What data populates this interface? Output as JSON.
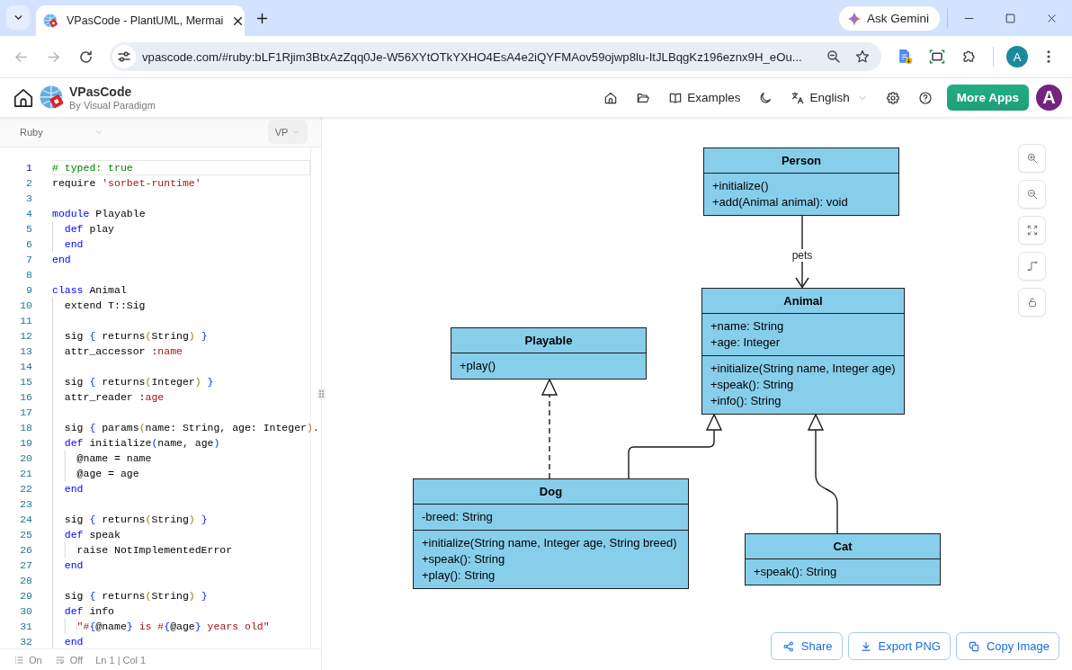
{
  "browser": {
    "tabs": [
      {
        "title": "VPasCode - PlantUML, Mermai",
        "selected": true
      }
    ],
    "gemini": "Ask Gemini",
    "nav": [
      {
        "kind": "back",
        "disabled": true
      },
      {
        "kind": "forward",
        "disabled": true
      },
      {
        "kind": "reload",
        "disabled": false
      }
    ],
    "url": "vpascode.com/#ruby:bLF1Rjim3BtxAzZqq0Je-W56XYtOTkYXHO4EsA4e2iQYFMAov59ojwp8lu-ItJLBqgKz196eznx9H_eOu...",
    "profile_initial": "A"
  },
  "header": {
    "app_name": "VPasCode",
    "app_subtitle": "By Visual Paradigm",
    "nav": [
      {
        "kind": "home"
      },
      {
        "kind": "folder"
      },
      {
        "kind": "examples",
        "label": "Examples"
      },
      {
        "kind": "theme"
      },
      {
        "kind": "language",
        "label": "English"
      },
      {
        "kind": "settings"
      },
      {
        "kind": "help"
      }
    ],
    "more_apps": "More Apps",
    "avatar_initial": "A"
  },
  "editor": {
    "language": "Ruby",
    "renderer": "VP",
    "lines": [
      {
        "number": "1",
        "active": true,
        "tokens": [
          {
            "text": "# typed: true",
            "kind": "comment"
          }
        ]
      },
      {
        "number": "2",
        "active": false,
        "tokens": [
          {
            "text": "require ",
            "kind": "plain"
          },
          {
            "text": "'sorbet-runtime'",
            "kind": "string"
          }
        ]
      },
      {
        "number": "3",
        "active": false
      },
      {
        "number": "4",
        "active": false,
        "tokens": [
          {
            "text": "module",
            "kind": "keyword"
          },
          {
            "text": " Playable",
            "kind": "plain"
          }
        ]
      },
      {
        "number": "5",
        "active": false,
        "tokens": [
          {
            "text": "  def",
            "kind": "keyword"
          },
          {
            "text": " play",
            "kind": "plain"
          }
        ]
      },
      {
        "number": "6",
        "active": false,
        "tokens": [
          {
            "text": "  end",
            "kind": "keyword"
          }
        ]
      },
      {
        "number": "7",
        "active": false,
        "tokens": [
          {
            "text": "end",
            "kind": "keyword"
          }
        ]
      },
      {
        "number": "8",
        "active": false
      },
      {
        "number": "9",
        "active": false,
        "tokens": [
          {
            "text": "class",
            "kind": "keyword"
          },
          {
            "text": " Animal",
            "kind": "plain"
          }
        ]
      },
      {
        "number": "10",
        "active": false,
        "tokens": [
          {
            "text": "  extend T::Sig",
            "kind": "plain"
          }
        ]
      },
      {
        "number": "11",
        "active": false
      },
      {
        "number": "12",
        "active": false,
        "tokens": [
          {
            "text": "  sig ",
            "kind": "plain"
          },
          {
            "text": "{",
            "kind": "bracket"
          },
          {
            "text": " returns",
            "kind": "plain"
          },
          {
            "text": "(",
            "kind": "paren"
          },
          {
            "text": "String",
            "kind": "plain"
          },
          {
            "text": ") ",
            "kind": "paren"
          },
          {
            "text": "}",
            "kind": "bracket"
          }
        ]
      },
      {
        "number": "13",
        "active": false,
        "tokens": [
          {
            "text": "  attr_accessor :",
            "kind": "plain"
          },
          {
            "text": "name",
            "kind": "symbol"
          }
        ]
      },
      {
        "number": "14",
        "active": false
      },
      {
        "number": "15",
        "active": false,
        "tokens": [
          {
            "text": "  sig ",
            "kind": "plain"
          },
          {
            "text": "{",
            "kind": "bracket"
          },
          {
            "text": " returns",
            "kind": "plain"
          },
          {
            "text": "(",
            "kind": "paren"
          },
          {
            "text": "Integer",
            "kind": "plain"
          },
          {
            "text": ") ",
            "kind": "paren"
          },
          {
            "text": "}",
            "kind": "bracket"
          }
        ]
      },
      {
        "number": "16",
        "active": false,
        "tokens": [
          {
            "text": "  attr_reader :",
            "kind": "plain"
          },
          {
            "text": "age",
            "kind": "symbol"
          }
        ]
      },
      {
        "number": "17",
        "active": false
      },
      {
        "number": "18",
        "active": false,
        "tokens": [
          {
            "text": "  sig ",
            "kind": "plain"
          },
          {
            "text": "{",
            "kind": "bracket"
          },
          {
            "text": " params",
            "kind": "plain"
          },
          {
            "text": "(",
            "kind": "paren"
          },
          {
            "text": "name: String, age: Integer",
            "kind": "plain"
          },
          {
            "text": ")",
            "kind": "paren"
          },
          {
            "text": ".",
            "kind": "plain"
          }
        ]
      },
      {
        "number": "19",
        "active": false,
        "tokens": [
          {
            "text": "  def",
            "kind": "keyword"
          },
          {
            "text": " initialize",
            "kind": "plain"
          },
          {
            "text": "(",
            "kind": "bracket"
          },
          {
            "text": "name, age",
            "kind": "plain"
          },
          {
            "text": ")",
            "kind": "bracket"
          }
        ]
      },
      {
        "number": "20",
        "active": false,
        "tokens": [
          {
            "text": "    @name = name",
            "kind": "plain"
          }
        ]
      },
      {
        "number": "21",
        "active": false,
        "tokens": [
          {
            "text": "    @age = age",
            "kind": "plain"
          }
        ]
      },
      {
        "number": "22",
        "active": false,
        "tokens": [
          {
            "text": "  end",
            "kind": "keyword"
          }
        ]
      },
      {
        "number": "23",
        "active": false
      },
      {
        "number": "24",
        "active": false,
        "tokens": [
          {
            "text": "  sig ",
            "kind": "plain"
          },
          {
            "text": "{",
            "kind": "bracket"
          },
          {
            "text": " returns",
            "kind": "plain"
          },
          {
            "text": "(",
            "kind": "paren"
          },
          {
            "text": "String",
            "kind": "plain"
          },
          {
            "text": ") ",
            "kind": "paren"
          },
          {
            "text": "}",
            "kind": "bracket"
          }
        ]
      },
      {
        "number": "25",
        "active": false,
        "tokens": [
          {
            "text": "  def",
            "kind": "keyword"
          },
          {
            "text": " speak",
            "kind": "plain"
          }
        ]
      },
      {
        "number": "26",
        "active": false,
        "tokens": [
          {
            "text": "    raise NotImplementedError",
            "kind": "plain"
          }
        ]
      },
      {
        "number": "27",
        "active": false,
        "tokens": [
          {
            "text": "  end",
            "kind": "keyword"
          }
        ]
      },
      {
        "number": "28",
        "active": false
      },
      {
        "number": "29",
        "active": false,
        "tokens": [
          {
            "text": "  sig ",
            "kind": "plain"
          },
          {
            "text": "{",
            "kind": "bracket"
          },
          {
            "text": " returns",
            "kind": "plain"
          },
          {
            "text": "(",
            "kind": "paren"
          },
          {
            "text": "String",
            "kind": "plain"
          },
          {
            "text": ") ",
            "kind": "paren"
          },
          {
            "text": "}",
            "kind": "bracket"
          }
        ]
      },
      {
        "number": "30",
        "active": false,
        "tokens": [
          {
            "text": "  def",
            "kind": "keyword"
          },
          {
            "text": " info",
            "kind": "plain"
          }
        ]
      },
      {
        "number": "31",
        "active": false,
        "tokens": [
          {
            "text": "    \"#",
            "kind": "string"
          },
          {
            "text": "{",
            "kind": "bracket"
          },
          {
            "text": "@name",
            "kind": "plain"
          },
          {
            "text": "}",
            "kind": "bracket"
          },
          {
            "text": " is #",
            "kind": "string"
          },
          {
            "text": "{",
            "kind": "bracket"
          },
          {
            "text": "@age",
            "kind": "plain"
          },
          {
            "text": "}",
            "kind": "bracket"
          },
          {
            "text": " years old\"",
            "kind": "string"
          }
        ]
      },
      {
        "number": "32",
        "active": false,
        "tokens": [
          {
            "text": "  end",
            "kind": "keyword"
          }
        ]
      }
    ],
    "status_bar": [
      {
        "kind": "list",
        "label": "On"
      },
      {
        "kind": "wrap",
        "label": "Off"
      },
      {
        "kind": "position",
        "label": "Ln 1 | Col 1"
      }
    ]
  },
  "diagram": {
    "classes": [
      {
        "name": "Person",
        "sections": [
          [
            "+initialize()",
            "+add(Animal animal): void"
          ]
        ]
      },
      {
        "name": "Playable",
        "sections": [
          [
            "+play()"
          ]
        ]
      },
      {
        "name": "Animal",
        "sections": [
          [
            "+name: String",
            "+age: Integer"
          ],
          [
            "+initialize(String name, Integer age)",
            "+speak(): String",
            "+info(): String"
          ]
        ]
      },
      {
        "name": "Dog",
        "sections": [
          [
            "-breed: String"
          ],
          [
            "+initialize(String name, Integer age, String breed)",
            "+speak(): String",
            "+play(): String"
          ]
        ]
      },
      {
        "name": "Cat",
        "sections": [
          [
            "+speak(): String"
          ]
        ]
      }
    ],
    "relations": [
      {
        "kind": "association",
        "label": "pets"
      },
      {
        "kind": "realization"
      },
      {
        "kind": "inheritance"
      },
      {
        "kind": "inheritance"
      }
    ]
  },
  "canvas_tools": [
    {
      "kind": "zoom-in"
    },
    {
      "kind": "zoom-out"
    },
    {
      "kind": "fit"
    },
    {
      "kind": "connector"
    },
    {
      "kind": "lock"
    }
  ],
  "actions": [
    {
      "kind": "share",
      "label": "Share"
    },
    {
      "kind": "export",
      "label": "Export PNG"
    },
    {
      "kind": "copy",
      "label": "Copy Image"
    }
  ]
}
